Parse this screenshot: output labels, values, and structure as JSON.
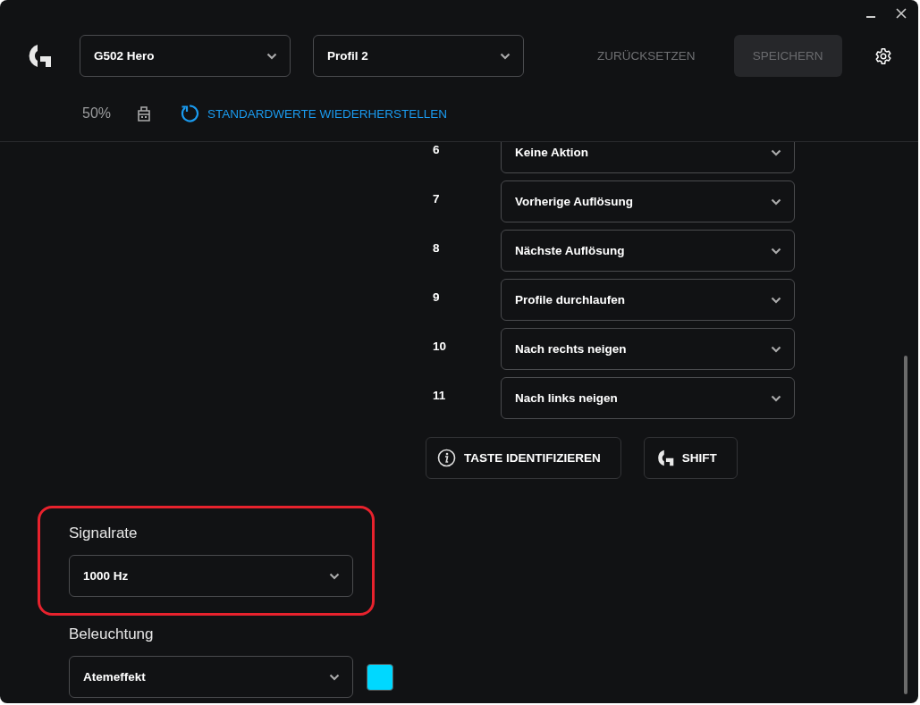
{
  "header": {
    "device_select": {
      "value": "G502 Hero"
    },
    "profile_select": {
      "value": "Profil 2"
    },
    "reset_button": {
      "label": "ZURÜCKSETZEN"
    },
    "save_button": {
      "label": "SPEICHERN",
      "disabled": true
    }
  },
  "status": {
    "battery": "50%",
    "restore_defaults": "STANDARDWERTE WIEDERHERSTELLEN"
  },
  "button_assignments": [
    {
      "number": "6",
      "action": "Keine Aktion"
    },
    {
      "number": "7",
      "action": "Vorherige Auflösung"
    },
    {
      "number": "8",
      "action": "Nächste Auflösung"
    },
    {
      "number": "9",
      "action": "Profile durchlaufen"
    },
    {
      "number": "10",
      "action": "Nach rechts neigen"
    },
    {
      "number": "11",
      "action": "Nach links neigen"
    }
  ],
  "actions": [
    {
      "kind": "identify",
      "label": "TASTE IDENTIFIZIEREN"
    },
    {
      "kind": "shift",
      "label": "SHIFT"
    }
  ],
  "report_rate": {
    "label": "Signalrate",
    "value": "1000 Hz",
    "highlighted": true
  },
  "lighting": {
    "label": "Beleuchtung",
    "value": "Atemeffekt",
    "color": "#00d8ff"
  }
}
